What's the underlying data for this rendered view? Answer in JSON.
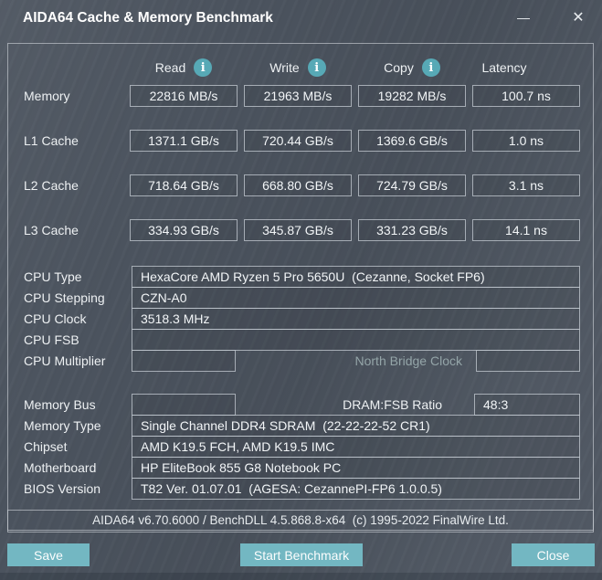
{
  "window": {
    "title": "AIDA64 Cache & Memory Benchmark"
  },
  "icons": {
    "minimize": "—",
    "close": "✕",
    "info": "i"
  },
  "colors": {
    "background": "#4b535e",
    "panel_border": "#c7cdd3",
    "accent_button": "#73b7c2",
    "info_icon_bg": "#57a9b6",
    "disabled_text": "#94a5a8"
  },
  "benchmark": {
    "columns": [
      "Read",
      "Write",
      "Copy",
      "Latency"
    ],
    "rows": [
      {
        "label": "Memory",
        "values": [
          "22816 MB/s",
          "21963 MB/s",
          "19282 MB/s",
          "100.7 ns"
        ]
      },
      {
        "label": "L1 Cache",
        "values": [
          "1371.1 GB/s",
          "720.44 GB/s",
          "1369.6 GB/s",
          "1.0 ns"
        ]
      },
      {
        "label": "L2 Cache",
        "values": [
          "718.64 GB/s",
          "668.80 GB/s",
          "724.79 GB/s",
          "3.1 ns"
        ]
      },
      {
        "label": "L3 Cache",
        "values": [
          "334.93 GB/s",
          "345.87 GB/s",
          "331.23 GB/s",
          "14.1 ns"
        ]
      }
    ]
  },
  "cpu": {
    "rows": [
      {
        "label": "CPU Type",
        "value": "HexaCore AMD Ryzen 5 Pro 5650U  (Cezanne, Socket FP6)"
      },
      {
        "label": "CPU Stepping",
        "value": "CZN-A0"
      },
      {
        "label": "CPU Clock",
        "value": "3518.3 MHz"
      },
      {
        "label": "CPU FSB",
        "value": ""
      }
    ],
    "multiplier_label": "CPU Multiplier",
    "multiplier_value": "",
    "north_bridge_label": "North Bridge Clock",
    "north_bridge_value": ""
  },
  "memory": {
    "bus_label": "Memory Bus",
    "bus_value": "",
    "dram_fsb_label": "DRAM:FSB Ratio",
    "dram_fsb_value": "48:3",
    "rows": [
      {
        "label": "Memory Type",
        "value": "Single Channel DDR4 SDRAM  (22-22-22-52 CR1)"
      },
      {
        "label": "Chipset",
        "value": "AMD K19.5 FCH, AMD K19.5 IMC"
      },
      {
        "label": "Motherboard",
        "value": "HP EliteBook 855 G8 Notebook PC"
      },
      {
        "label": "BIOS Version",
        "value": "T82 Ver. 01.07.01  (AGESA: CezannePI-FP6 1.0.0.5)"
      }
    ]
  },
  "footer": {
    "version_text": "AIDA64 v6.70.6000 / BenchDLL 4.5.868.8-x64  (c) 1995-2022 FinalWire Ltd.",
    "save_label": "Save",
    "start_label": "Start Benchmark",
    "close_label": "Close"
  }
}
